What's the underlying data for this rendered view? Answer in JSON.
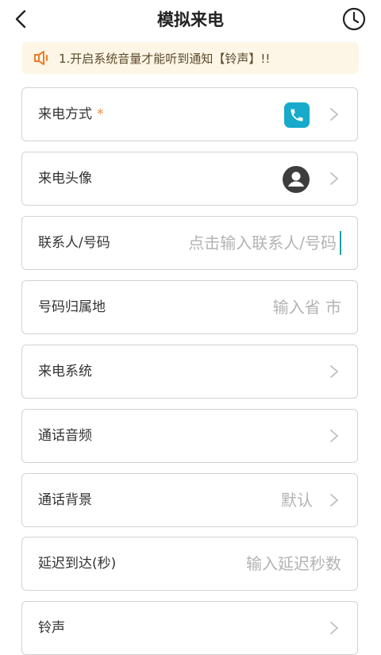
{
  "header": {
    "title": "模拟来电"
  },
  "notice": {
    "text": "1.开启系统音量才能听到通知【铃声】!!"
  },
  "rows": {
    "call_method": {
      "label": "来电方式",
      "required_mark": "*"
    },
    "caller_avatar": {
      "label": "来电头像"
    },
    "contact_number": {
      "label": "联系人/号码",
      "placeholder": "点击输入联系人/号码"
    },
    "number_location": {
      "label": "号码归属地",
      "placeholder": "输入省 市"
    },
    "call_system": {
      "label": "来电系统"
    },
    "call_audio": {
      "label": "通话音频"
    },
    "call_background": {
      "label": "通话背景",
      "value": "默认"
    },
    "delay_arrival": {
      "label": "延迟到达(秒)",
      "placeholder": "输入延迟秒数"
    },
    "ringtone": {
      "label": "铃声"
    }
  },
  "colors": {
    "accent_teal": "#17aacb",
    "required_orange": "#f08b3a",
    "notice_bg": "#fdf6e6",
    "notice_icon": "#f07a2a"
  },
  "icons": {
    "back": "chevron-left-icon",
    "history": "clock-icon",
    "notice": "speaker-icon",
    "call_method": "phone-icon",
    "avatar": "avatar-icon",
    "chevron": "chevron-right-icon"
  }
}
